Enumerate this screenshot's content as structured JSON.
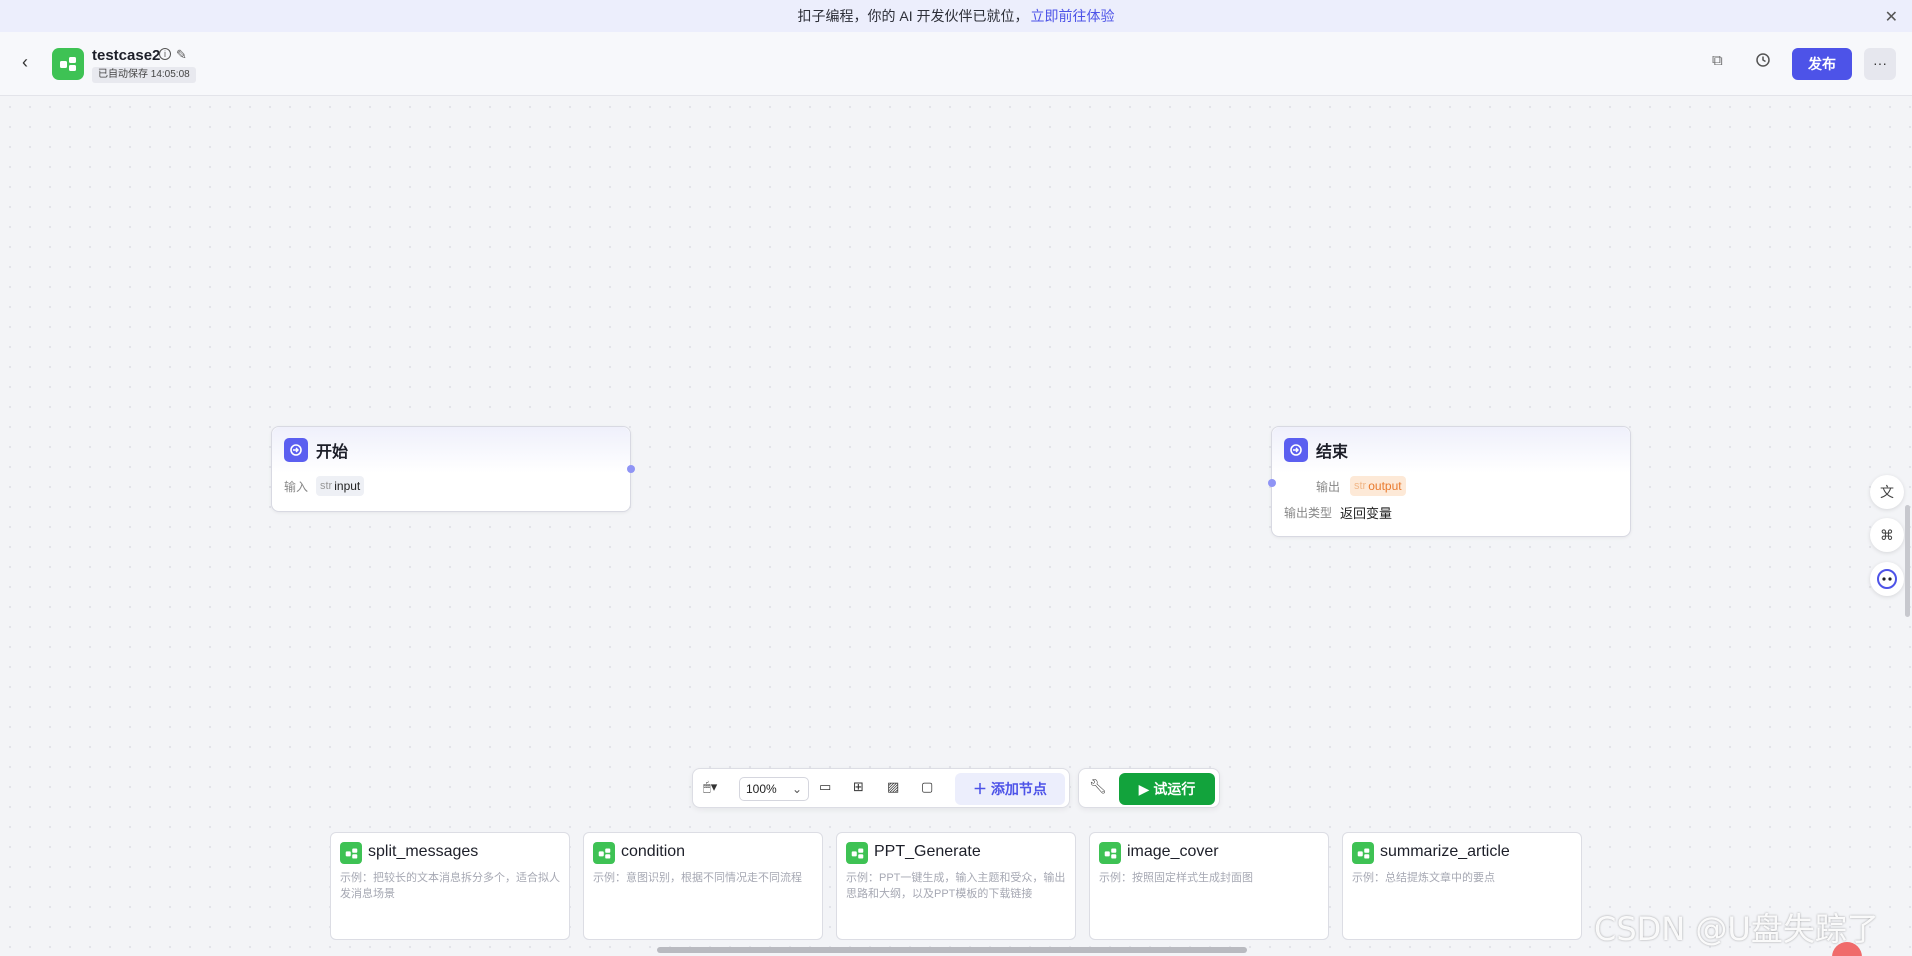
{
  "banner": {
    "text": "扣子编程，你的 AI 开发伙伴已就位，",
    "link": "立即前往体验",
    "close": "✕"
  },
  "header": {
    "back": "‹",
    "title": "testcase2",
    "saved": "已自动保存 14:05:08",
    "publish": "发布",
    "more": "···"
  },
  "nodes": {
    "start": {
      "title": "开始",
      "input_label": "输入",
      "var_type": "str",
      "var_name": "input"
    },
    "end": {
      "title": "结束",
      "output_label": "输出",
      "var_type": "str",
      "var_name": "output",
      "output_type_label": "输出类型",
      "output_type_value": "返回变量"
    }
  },
  "toolbar": {
    "zoom": "100%",
    "add_node": "＋ 添加节点",
    "run": "▶ 试运行"
  },
  "cards": [
    {
      "title": "split_messages",
      "desc": "示例：把较长的文本消息拆分多个，适合拟人发消息场景"
    },
    {
      "title": "condition",
      "desc": "示例：意图识别，根据不同情况走不同流程"
    },
    {
      "title": "PPT_Generate",
      "desc": "示例：PPT一键生成，输入主题和受众，输出思路和大纲，以及PPT模板的下载链接"
    },
    {
      "title": "image_cover",
      "desc": "示例：按照固定样式生成封面图"
    },
    {
      "title": "summarize_article",
      "desc": "示例：总结提炼文章中的要点"
    }
  ],
  "watermark": "CSDN @U盘失踪了",
  "colors": {
    "primary": "#4d53e8",
    "run_green": "#12a33c",
    "app_icon": "#3ec254",
    "node_icon": "#5b5ff0"
  }
}
